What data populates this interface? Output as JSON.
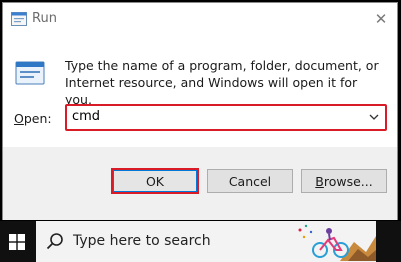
{
  "dialog": {
    "title": "Run",
    "close_glyph": "✕",
    "description": "Type the name of a program, folder, document, or Internet resource, and Windows will open it for you.",
    "open_label_first": "O",
    "open_label_rest": "pen:",
    "input_value": "cmd",
    "buttons": {
      "ok": "OK",
      "cancel": "Cancel",
      "browse_underlined": "B",
      "browse_rest": "rowse..."
    },
    "highlight_color": "#d81b27"
  },
  "taskbar": {
    "search_placeholder": "Type here to search"
  },
  "icons": {
    "app": "run-app-icon",
    "close": "close-icon",
    "dropdown": "chevron-down-icon",
    "start": "windows-logo-icon",
    "search": "search-icon"
  }
}
